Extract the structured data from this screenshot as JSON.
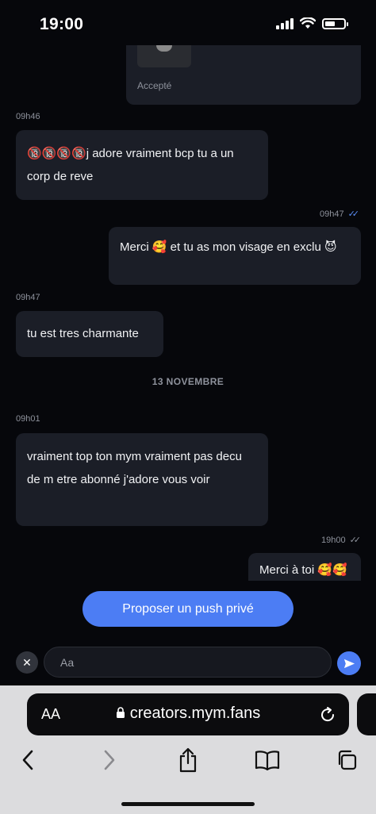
{
  "status": {
    "time": "19:00"
  },
  "messages": {
    "accepted_label": "Accepté",
    "m1": {
      "time": "09h46",
      "text": "🔞🔞🔞🔞j adore vraiment bcp tu a un corp de reve"
    },
    "m2": {
      "time": "09h47",
      "text": "Merci 🥰 et tu as mon visage en exclu 😈"
    },
    "m3": {
      "time": "09h47",
      "text": "tu est tres charmante"
    },
    "divider": "13 NOVEMBRE",
    "m4": {
      "time": "09h01",
      "text": "vraiment top ton mym vraiment pas decu de m etre abonné j'adore vous voir"
    },
    "m5": {
      "time": "19h00",
      "text": "Merci à toi 🥰🥰"
    }
  },
  "composer": {
    "push_label": "Proposer un push privé",
    "input_placeholder": "Aa"
  },
  "browser": {
    "aa_label": "AA",
    "url": "creators.mym.fans"
  },
  "colors": {
    "accent": "#4c7df4",
    "bubble": "#1b1e27",
    "background": "#06070b"
  }
}
